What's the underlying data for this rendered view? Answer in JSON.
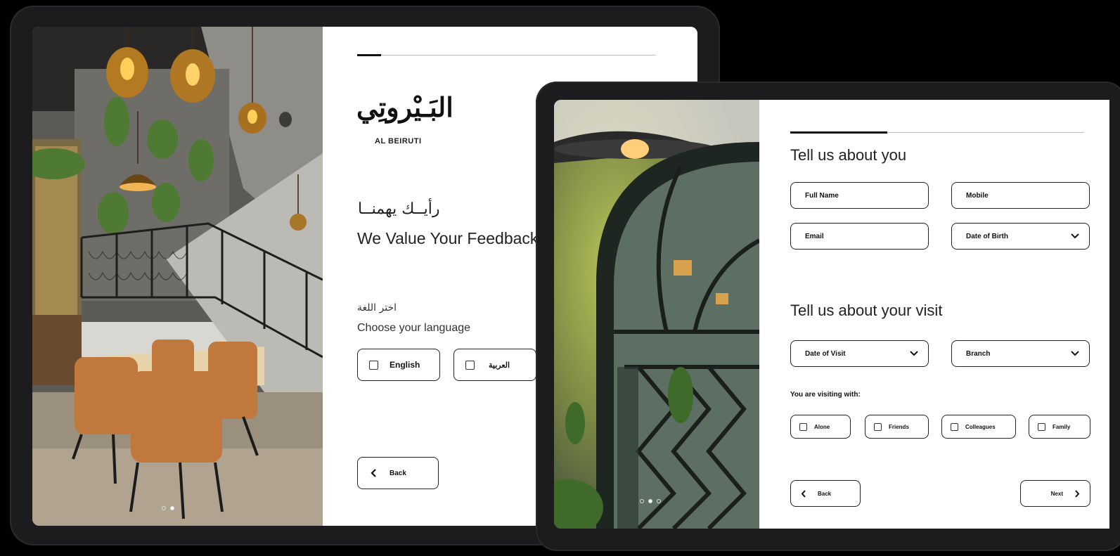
{
  "welcome_screen": {
    "logo_arabic": "البَـيْروتِي",
    "logo_latin": "AL BEIRUTI",
    "heading_arabic": "رأيــك يهمنــا",
    "heading_english": "We Value Your Feedback",
    "language_label_arabic": "اختر اللغة",
    "language_label_english": "Choose your language",
    "language_options": [
      "English",
      "العربية"
    ],
    "back_label": "Back",
    "progress": 0.08,
    "carousel_active": 1
  },
  "form_screen": {
    "section_about_you": "Tell us about you",
    "fields": {
      "full_name": "Full Name",
      "mobile": "Mobile",
      "email": "Email",
      "date_of_birth": "Date of Birth"
    },
    "section_visit": "Tell us about your visit",
    "visit_fields": {
      "date_of_visit": "Date of Visit",
      "branch": "Branch"
    },
    "visiting_with_label": "You are visiting with:",
    "visiting_with_options": [
      "Alone",
      "Friends",
      "Colleagues",
      "Family"
    ],
    "back_label": "Back",
    "next_label": "Next",
    "progress": 0.33,
    "carousel_active": 1
  }
}
